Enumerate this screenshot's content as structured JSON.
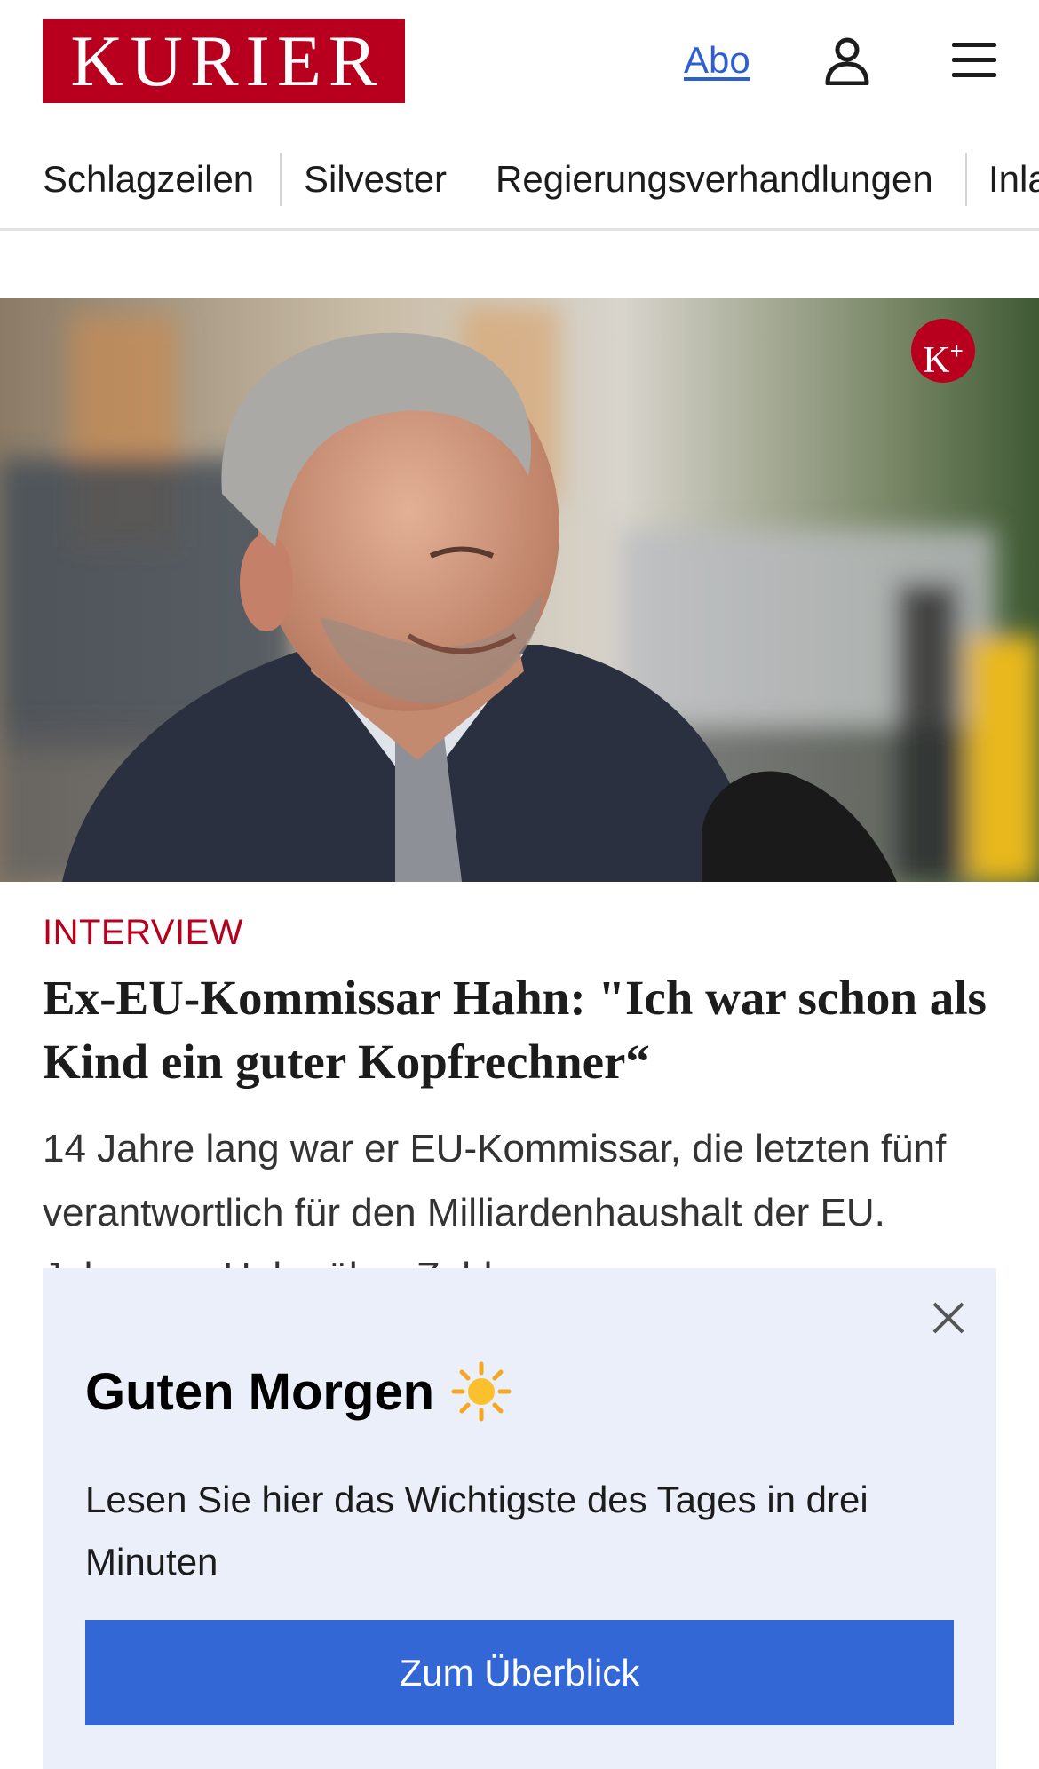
{
  "header": {
    "logo_text": "KURIER",
    "abo_label": "Abo",
    "user_icon": "user-icon",
    "menu_icon": "hamburger-menu-icon"
  },
  "nav": {
    "items": [
      {
        "label": "Schlagzeilen"
      },
      {
        "label": "Silvester"
      },
      {
        "label": "Regierungsverhandlungen"
      },
      {
        "label": "Inla"
      }
    ]
  },
  "article": {
    "premium_badge": "K",
    "premium_badge_plus": "+",
    "kicker": "INTERVIEW",
    "headline": "Ex-EU-Kommissar Hahn: \"Ich war schon als Kind ein guter Kopfrechner“",
    "teaser": "14 Jahre lang war er EU-Kommissar, die letzten fünf verantwortlich für den Milliardenhaushalt der EU. Johannes Hahn über Zahlen"
  },
  "overlay": {
    "title": "Guten Morgen",
    "title_icon": "sun-icon",
    "text": "Lesen Sie hier das Wichtigste des Tages in drei Minuten",
    "button_label": "Zum Überblick",
    "close_icon": "close-icon"
  },
  "colors": {
    "brand_red": "#b8001e",
    "link_blue": "#2d5fd3",
    "button_blue": "#3367d6",
    "overlay_bg": "#eaeff9"
  }
}
